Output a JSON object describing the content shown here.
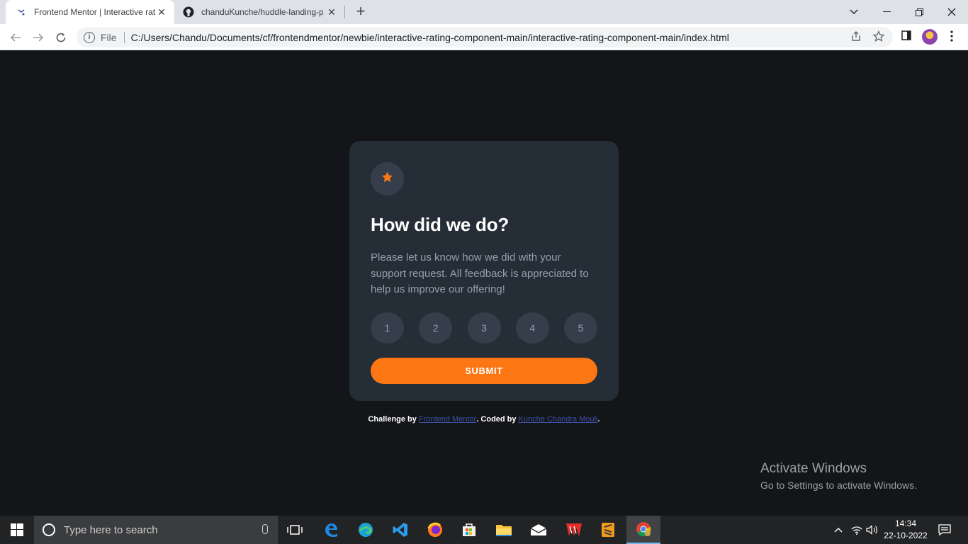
{
  "browser": {
    "tabs": [
      {
        "title": "Frontend Mentor | Interactive rat",
        "active": true
      },
      {
        "title": "chanduKunche/huddle-landing-p",
        "active": false
      }
    ],
    "new_tab_label": "+",
    "address": {
      "scheme": "File",
      "url": "C:/Users/Chandu/Documents/cf/frontendmentor/newbie/interactive-rating-component-main/interactive-rating-component-main/index.html"
    }
  },
  "card": {
    "title": "How did we do?",
    "description": "Please let us know how we did with your support request. All feedback is appreciated to help us improve our offering!",
    "ratings": [
      "1",
      "2",
      "3",
      "4",
      "5"
    ],
    "submit_label": "SUBMIT"
  },
  "attribution": {
    "prefix": "Challenge by ",
    "link1": "Frontend Mentor",
    "middle": ". Coded by ",
    "link2": "Kunche Chandra Mouli",
    "suffix": "."
  },
  "watermark": {
    "line1": "Activate Windows",
    "line2": "Go to Settings to activate Windows."
  },
  "taskbar": {
    "search_placeholder": "Type here to search",
    "time": "14:34",
    "date": "22-10-2022"
  },
  "colors": {
    "page_bg": "#131518",
    "card_bg": "#252d37",
    "accent_orange": "#fc7614",
    "rating_bg": "#353e4a"
  }
}
